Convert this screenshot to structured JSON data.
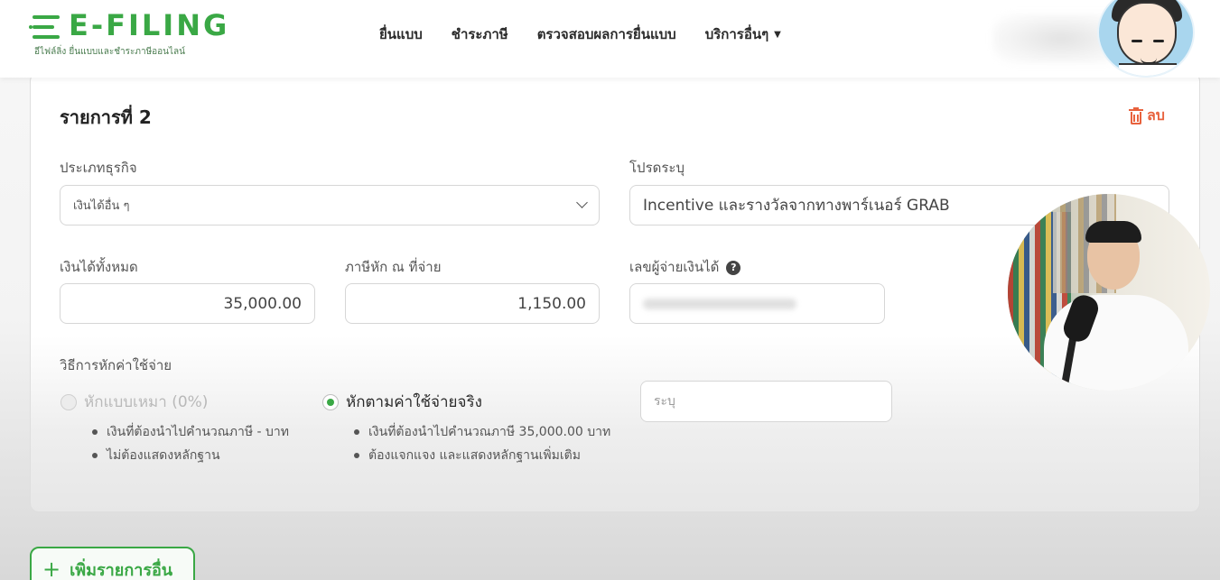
{
  "header": {
    "logo_text": "E-FILING",
    "logo_sub": "อีไฟล์ลิ่ง ยื่นแบบและชำระภาษีออนไลน์",
    "nav": [
      {
        "label": "ยื่นแบบ"
      },
      {
        "label": "ชำระภาษี"
      },
      {
        "label": "ตรวจสอบผลการยื่นแบบ"
      },
      {
        "label": "บริการอื่นๆ"
      }
    ]
  },
  "item": {
    "title": "รายการที่ 2",
    "delete_label": "ลบ",
    "business_type_label": "ประเภทธุรกิจ",
    "business_type_value": "เงินได้อื่น ๆ",
    "specify_label": "โปรดระบุ",
    "specify_value": "Incentive และรางวัลจากทางพาร์เนอร์ GRAB",
    "total_income_label": "เงินได้ทั้งหมด",
    "total_income_value": "35,000.00",
    "withholding_label": "ภาษีหัก ณ ที่จ่าย",
    "withholding_value": "1,150.00",
    "payer_id_label": "เลขผู้จ่ายเงินได้",
    "deduction_label": "วิธีการหักค่าใช้จ่าย",
    "option_flat": {
      "label": "หักแบบเหมา (0%)",
      "bullets": [
        "เงินที่ต้องนำไปคำนวณภาษี - บาท",
        "ไม่ต้องแสดงหลักฐาน"
      ]
    },
    "option_actual": {
      "label": "หักตามค่าใช้จ่ายจริง",
      "bullets": [
        "เงินที่ต้องนำไปคำนวณภาษี 35,000.00 บาท",
        "ต้องแจกแจง และแสดงหลักฐานเพิ่มเติม"
      ]
    },
    "actual_placeholder": "ระบุ"
  },
  "add_button_label": "เพิ่มรายการอื่น",
  "icons": {
    "delete": "trash-icon",
    "help": "help-icon",
    "dropdown": "chevron-down-icon",
    "add": "plus-icon"
  },
  "colors": {
    "brand_green": "#3aa845",
    "delete_orange": "#e8623d"
  }
}
